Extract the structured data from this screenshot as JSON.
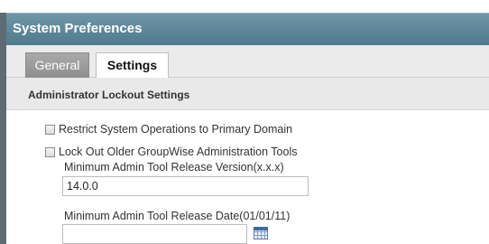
{
  "window": {
    "title": "System Preferences"
  },
  "tabs": [
    {
      "label": "General",
      "selected": false
    },
    {
      "label": "Settings",
      "selected": true
    }
  ],
  "section": {
    "title": "Administrator Lockout Settings"
  },
  "options": {
    "restrict_label": "Restrict System Operations to Primary Domain",
    "restrict_checked": false,
    "lockout_label": "Lock Out Older GroupWise Administration Tools",
    "lockout_checked": false
  },
  "fields": {
    "min_version_label": "Minimum Admin Tool Release Version(x.x.x)",
    "min_version_value": "14.0.0",
    "min_date_label": "Minimum Admin Tool Release Date(01/01/11)",
    "min_date_value": ""
  },
  "icons": {
    "date_picker": "calendar-icon"
  }
}
